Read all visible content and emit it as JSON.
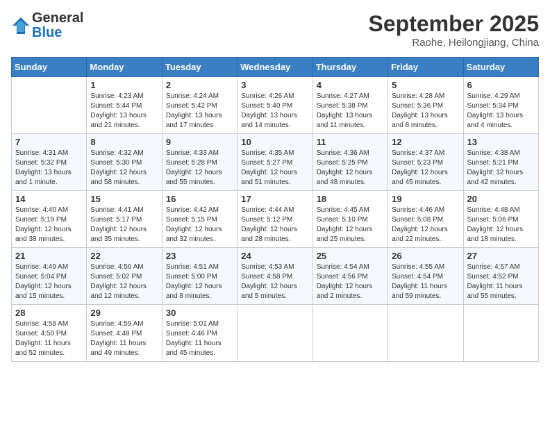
{
  "header": {
    "logo_general": "General",
    "logo_blue": "Blue",
    "month_title": "September 2025",
    "subtitle": "Raohe, Heilongjiang, China"
  },
  "days_of_week": [
    "Sunday",
    "Monday",
    "Tuesday",
    "Wednesday",
    "Thursday",
    "Friday",
    "Saturday"
  ],
  "weeks": [
    [
      {
        "day": "",
        "info": ""
      },
      {
        "day": "1",
        "info": "Sunrise: 4:23 AM\nSunset: 5:44 PM\nDaylight: 13 hours\nand 21 minutes."
      },
      {
        "day": "2",
        "info": "Sunrise: 4:24 AM\nSunset: 5:42 PM\nDaylight: 13 hours\nand 17 minutes."
      },
      {
        "day": "3",
        "info": "Sunrise: 4:26 AM\nSunset: 5:40 PM\nDaylight: 13 hours\nand 14 minutes."
      },
      {
        "day": "4",
        "info": "Sunrise: 4:27 AM\nSunset: 5:38 PM\nDaylight: 13 hours\nand 11 minutes."
      },
      {
        "day": "5",
        "info": "Sunrise: 4:28 AM\nSunset: 5:36 PM\nDaylight: 13 hours\nand 8 minutes."
      },
      {
        "day": "6",
        "info": "Sunrise: 4:29 AM\nSunset: 5:34 PM\nDaylight: 13 hours\nand 4 minutes."
      }
    ],
    [
      {
        "day": "7",
        "info": "Sunrise: 4:31 AM\nSunset: 5:32 PM\nDaylight: 13 hours\nand 1 minute."
      },
      {
        "day": "8",
        "info": "Sunrise: 4:32 AM\nSunset: 5:30 PM\nDaylight: 12 hours\nand 58 minutes."
      },
      {
        "day": "9",
        "info": "Sunrise: 4:33 AM\nSunset: 5:28 PM\nDaylight: 12 hours\nand 55 minutes."
      },
      {
        "day": "10",
        "info": "Sunrise: 4:35 AM\nSunset: 5:27 PM\nDaylight: 12 hours\nand 51 minutes."
      },
      {
        "day": "11",
        "info": "Sunrise: 4:36 AM\nSunset: 5:25 PM\nDaylight: 12 hours\nand 48 minutes."
      },
      {
        "day": "12",
        "info": "Sunrise: 4:37 AM\nSunset: 5:23 PM\nDaylight: 12 hours\nand 45 minutes."
      },
      {
        "day": "13",
        "info": "Sunrise: 4:38 AM\nSunset: 5:21 PM\nDaylight: 12 hours\nand 42 minutes."
      }
    ],
    [
      {
        "day": "14",
        "info": "Sunrise: 4:40 AM\nSunset: 5:19 PM\nDaylight: 12 hours\nand 38 minutes."
      },
      {
        "day": "15",
        "info": "Sunrise: 4:41 AM\nSunset: 5:17 PM\nDaylight: 12 hours\nand 35 minutes."
      },
      {
        "day": "16",
        "info": "Sunrise: 4:42 AM\nSunset: 5:15 PM\nDaylight: 12 hours\nand 32 minutes."
      },
      {
        "day": "17",
        "info": "Sunrise: 4:44 AM\nSunset: 5:12 PM\nDaylight: 12 hours\nand 28 minutes."
      },
      {
        "day": "18",
        "info": "Sunrise: 4:45 AM\nSunset: 5:10 PM\nDaylight: 12 hours\nand 25 minutes."
      },
      {
        "day": "19",
        "info": "Sunrise: 4:46 AM\nSunset: 5:08 PM\nDaylight: 12 hours\nand 22 minutes."
      },
      {
        "day": "20",
        "info": "Sunrise: 4:48 AM\nSunset: 5:06 PM\nDaylight: 12 hours\nand 18 minutes."
      }
    ],
    [
      {
        "day": "21",
        "info": "Sunrise: 4:49 AM\nSunset: 5:04 PM\nDaylight: 12 hours\nand 15 minutes."
      },
      {
        "day": "22",
        "info": "Sunrise: 4:50 AM\nSunset: 5:02 PM\nDaylight: 12 hours\nand 12 minutes."
      },
      {
        "day": "23",
        "info": "Sunrise: 4:51 AM\nSunset: 5:00 PM\nDaylight: 12 hours\nand 8 minutes."
      },
      {
        "day": "24",
        "info": "Sunrise: 4:53 AM\nSunset: 4:58 PM\nDaylight: 12 hours\nand 5 minutes."
      },
      {
        "day": "25",
        "info": "Sunrise: 4:54 AM\nSunset: 4:56 PM\nDaylight: 12 hours\nand 2 minutes."
      },
      {
        "day": "26",
        "info": "Sunrise: 4:55 AM\nSunset: 4:54 PM\nDaylight: 11 hours\nand 59 minutes."
      },
      {
        "day": "27",
        "info": "Sunrise: 4:57 AM\nSunset: 4:52 PM\nDaylight: 11 hours\nand 55 minutes."
      }
    ],
    [
      {
        "day": "28",
        "info": "Sunrise: 4:58 AM\nSunset: 4:50 PM\nDaylight: 11 hours\nand 52 minutes."
      },
      {
        "day": "29",
        "info": "Sunrise: 4:59 AM\nSunset: 4:48 PM\nDaylight: 11 hours\nand 49 minutes."
      },
      {
        "day": "30",
        "info": "Sunrise: 5:01 AM\nSunset: 4:46 PM\nDaylight: 11 hours\nand 45 minutes."
      },
      {
        "day": "",
        "info": ""
      },
      {
        "day": "",
        "info": ""
      },
      {
        "day": "",
        "info": ""
      },
      {
        "day": "",
        "info": ""
      }
    ]
  ]
}
